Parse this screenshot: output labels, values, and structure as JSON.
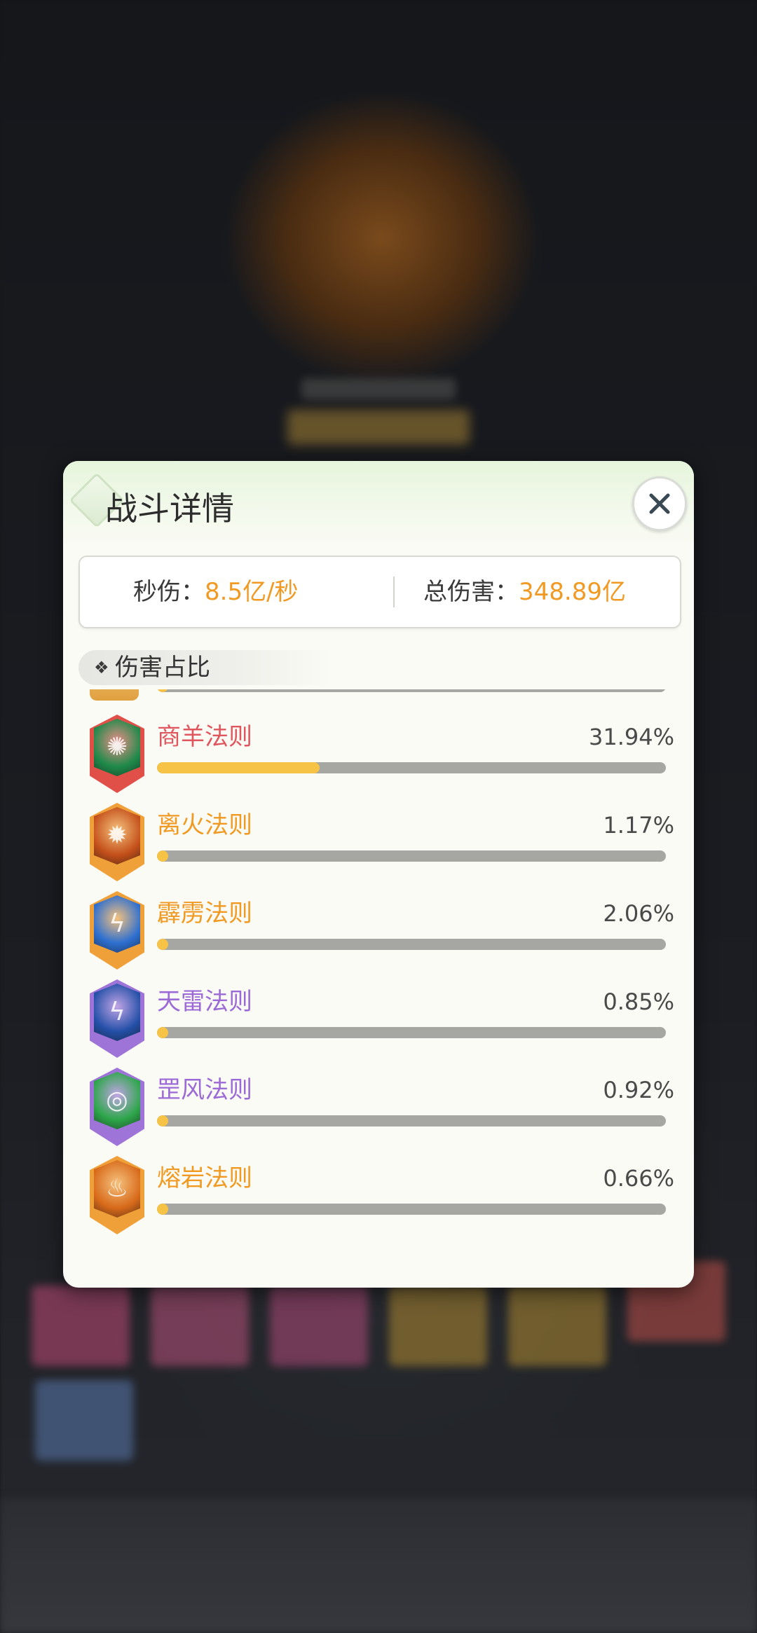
{
  "dialog": {
    "title": "战斗详情",
    "close_icon": "close-icon",
    "stats": {
      "dps_label": "秒伤：",
      "dps_value": "8.5亿/秒",
      "total_label": "总伤害：",
      "total_value": "348.89亿"
    },
    "section_title": "伤害占比",
    "section_icon": "❖",
    "partial_row": {
      "fraction": 0.02
    },
    "items": [
      {
        "name": "商羊法则",
        "percent": "31.94%",
        "fraction": 0.3194,
        "name_color": "#e0565f",
        "frame_color": "#e05048",
        "icon": "green-dragon-icon",
        "icon_bg": "#1f8a4a"
      },
      {
        "name": "离火法则",
        "percent": "1.17%",
        "fraction": 0.0117,
        "name_color": "#f19a23",
        "frame_color": "#f0a038",
        "icon": "fire-swirl-icon",
        "icon_bg": "#c4501a"
      },
      {
        "name": "霹雳法则",
        "percent": "2.06%",
        "fraction": 0.0206,
        "name_color": "#f19a23",
        "frame_color": "#f0a038",
        "icon": "lightning-icon",
        "icon_bg": "#2d6fd0"
      },
      {
        "name": "天雷法则",
        "percent": "0.85%",
        "fraction": 0.0085,
        "name_color": "#9b6ad6",
        "frame_color": "#9f74d8",
        "icon": "thunder-icon",
        "icon_bg": "#2450a8"
      },
      {
        "name": "罡风法则",
        "percent": "0.92%",
        "fraction": 0.0092,
        "name_color": "#9b6ad6",
        "frame_color": "#9f74d8",
        "icon": "wind-vortex-icon",
        "icon_bg": "#2da64a"
      },
      {
        "name": "熔岩法则",
        "percent": "0.66%",
        "fraction": 0.0066,
        "name_color": "#f19a23",
        "frame_color": "#f0a038",
        "icon": "lava-icon",
        "icon_bg": "#d86a1a"
      }
    ]
  }
}
